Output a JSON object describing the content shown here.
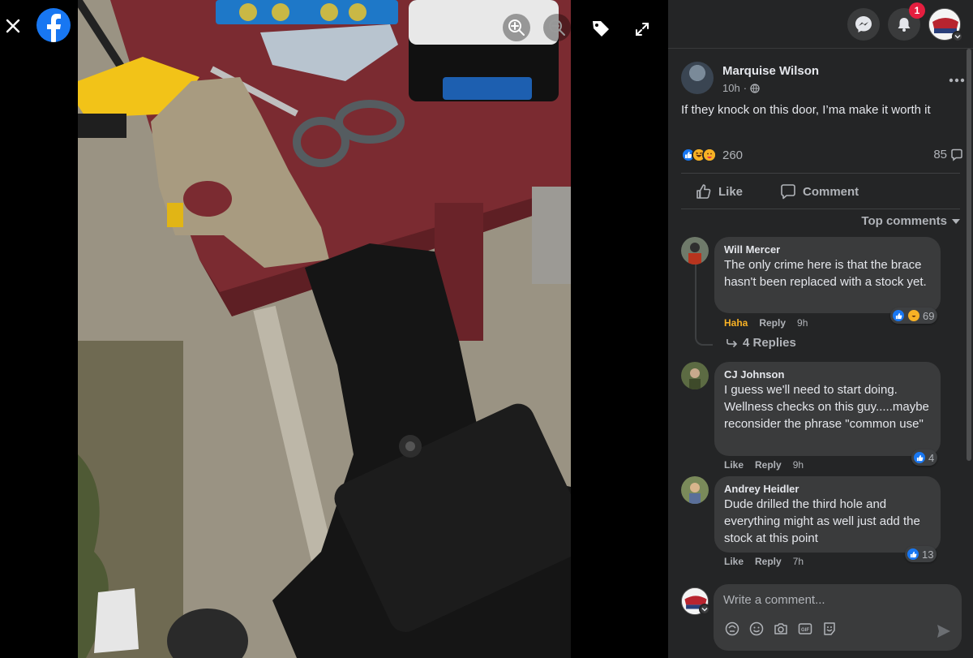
{
  "viewer": {
    "close_label": "✕"
  },
  "topbar": {
    "notification_count": "1"
  },
  "post": {
    "author": "Marquise Wilson",
    "time": "10h",
    "text": "If they knock on this door, I’ma make it worth it",
    "reaction_count": "260",
    "comment_count": "85",
    "like_label": "Like",
    "comment_label": "Comment",
    "sort_label": "Top comments"
  },
  "comments": [
    {
      "name": "Will Mercer",
      "text": "The only crime here is that the brace hasn't been replaced with a stock yet.",
      "reaction_label": "Haha",
      "reply_label": "Reply",
      "time": "9h",
      "reaction_count": "69",
      "replies_label": "4 Replies"
    },
    {
      "name": "CJ Johnson",
      "text": "I guess we'll need to start doing. Wellness checks on this guy.....maybe reconsider the phrase \"common use\"",
      "reaction_label": "Like",
      "reply_label": "Reply",
      "time": "9h",
      "reaction_count": "4"
    },
    {
      "name": "Andrey Heidler",
      "text": "Dude drilled the third hole and everything might as well just add the stock at this point",
      "reaction_label": "Like",
      "reply_label": "Reply",
      "time": "7h",
      "reaction_count": "13"
    }
  ],
  "composer": {
    "placeholder": "Write a comment..."
  },
  "colors": {
    "panel_bg": "#242526",
    "bubble_bg": "#3a3b3c",
    "facebook_blue": "#1877f2",
    "badge_red": "#e41e3f",
    "haha_yellow": "#f7b125"
  }
}
